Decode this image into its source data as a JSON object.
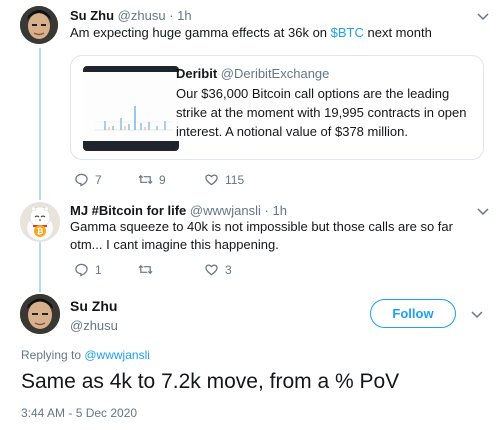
{
  "tweet1": {
    "name": "Su Zhu",
    "handle": "@zhusu",
    "time": "1h",
    "text_before": "Am expecting huge gamma effects at 36k on ",
    "cashtag": "$BTC",
    "text_after": " next month",
    "card": {
      "source_name": "Deribit",
      "source_handle": "@DeribitExchange",
      "text": "Our $36,000 Bitcoin call options are the leading strike at the moment with 19,995 contracts in open interest. A notional value of $378 million."
    },
    "replies": "7",
    "retweets": "9",
    "likes": "115"
  },
  "tweet2": {
    "name": "MJ #Bitcoin for life",
    "handle": "@wwwjansli",
    "time": "1h",
    "text": "Gamma squeeze to 40k is not impossible but those calls are so far otm... I cant imagine this happening.",
    "replies": "1",
    "retweets": "",
    "likes": "3"
  },
  "main": {
    "name": "Su Zhu",
    "handle": "@zhusu",
    "follow_label": "Follow",
    "replying_prefix": "Replying to ",
    "replying_to": "@wwwjansli",
    "text": "Same as 4k to 7.2k move, from a % PoV",
    "timestamp": "3:44 AM - 5 Dec 2020"
  },
  "colors": {
    "accent": "#1da1f2",
    "secondary_text": "#657786",
    "thread_line": "#b6dbf5"
  }
}
